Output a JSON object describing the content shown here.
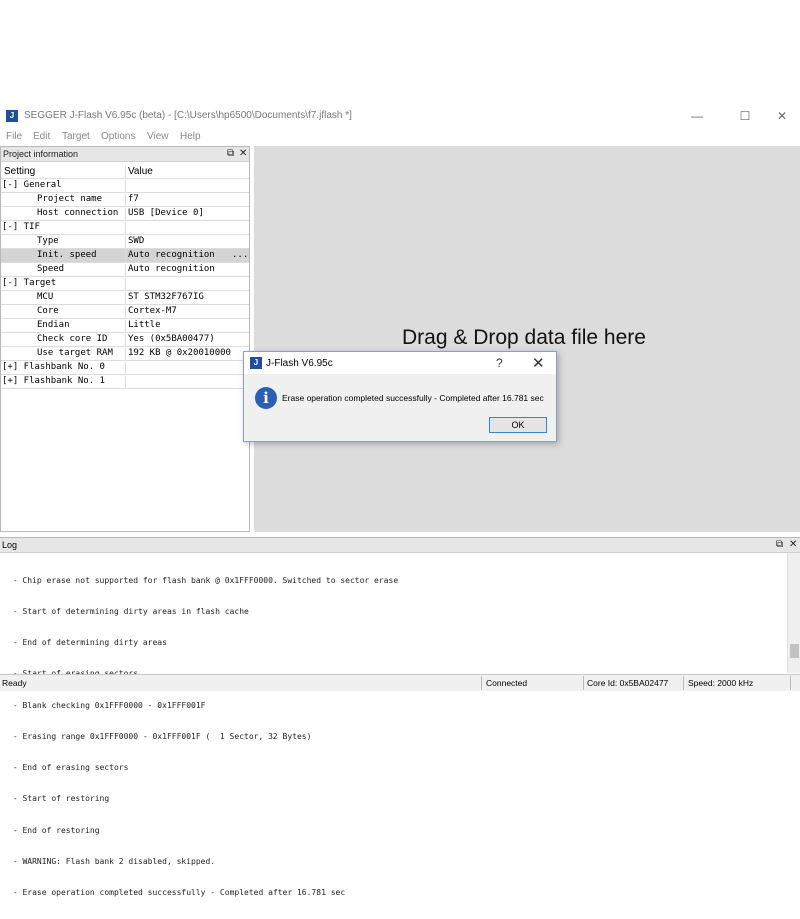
{
  "window": {
    "title": "SEGGER J-Flash V6.95c (beta) - [C:\\Users\\hp6500\\Documents\\f7.jflash *]",
    "app_icon": "jflash-logo-icon",
    "controls": {
      "minimize": "—",
      "maximize": "☐",
      "close": "✕"
    }
  },
  "menu": [
    "File",
    "Edit",
    "Target",
    "Options",
    "View",
    "Help"
  ],
  "project_panel": {
    "title": "Project information",
    "header_buttons": [
      "⧉",
      "✕"
    ],
    "columns": [
      "Setting",
      "Value"
    ],
    "rows": [
      {
        "setting": "[-] General",
        "value": ""
      },
      {
        "setting": "Project name",
        "value": "f7"
      },
      {
        "setting": "Host connection",
        "value": "USB [Device 0]"
      },
      {
        "setting": "[-] TIF",
        "value": ""
      },
      {
        "setting": "Type",
        "value": "SWD"
      },
      {
        "setting": "Init. speed",
        "value": "Auto recognition",
        "button": "..."
      },
      {
        "setting": "Speed",
        "value": "Auto recognition"
      },
      {
        "setting": "[-] Target",
        "value": ""
      },
      {
        "setting": "MCU",
        "value": "ST STM32F767IG"
      },
      {
        "setting": "Core",
        "value": "Cortex-M7"
      },
      {
        "setting": "Endian",
        "value": "Little"
      },
      {
        "setting": "Check core ID",
        "value": "Yes (0x5BA00477)"
      },
      {
        "setting": "Use target RAM",
        "value": "192 KB @ 0x20010000"
      },
      {
        "setting": "[+] Flashbank No. 0",
        "value": ""
      },
      {
        "setting": "[+] Flashbank No. 1",
        "value": ""
      }
    ]
  },
  "drop_area": {
    "text": "Drag & Drop data file here"
  },
  "dialog": {
    "title": "J-Flash V6.95c",
    "help": "?",
    "close": "✕",
    "icon": "info-icon",
    "message": "Erase operation completed successfully - Completed after 16.781 sec",
    "ok_label": "OK"
  },
  "log": {
    "title": "Log",
    "header_buttons": [
      "⧉",
      "✕"
    ],
    "lines": [
      " - Chip erase not supported for flash bank @ 0x1FFF0000. Switched to sector erase",
      " - Start of determining dirty areas in flash cache",
      " - End of determining dirty areas",
      " - Start of erasing sectors",
      " - Blank checking 0x1FFF0000 - 0x1FFF001F",
      " - Erasing range 0x1FFF0000 - 0x1FFF001F (  1 Sector, 32 Bytes)",
      " - End of erasing sectors",
      " - Start of restoring",
      " - End of restoring",
      " - WARNING: Flash bank 2 disabled, skipped.",
      " - Erase operation completed successfully - Completed after 16.781 sec"
    ]
  },
  "statusbar": {
    "status": "Ready",
    "connection": "Connected",
    "core_id": "Core Id: 0x5BA02477",
    "speed": "Speed: 2000 kHz"
  },
  "colors": {
    "accent": "#2b5fb3",
    "drop_bg": "#dcdcdc",
    "selected_row": "#d4d4d4"
  }
}
